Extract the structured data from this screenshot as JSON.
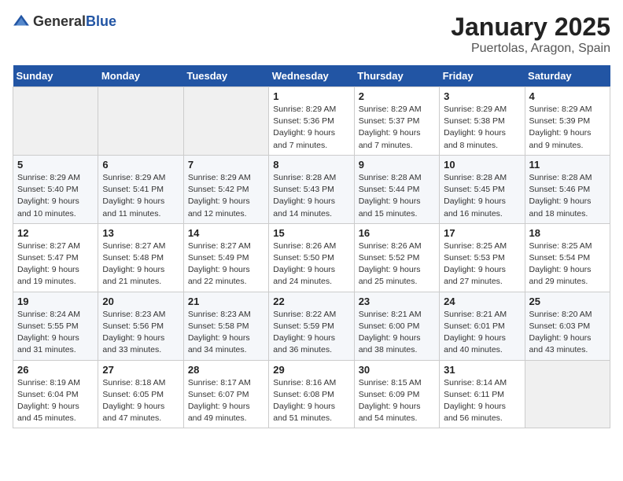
{
  "logo": {
    "text_general": "General",
    "text_blue": "Blue"
  },
  "title": "January 2025",
  "subtitle": "Puertolas, Aragon, Spain",
  "days_of_week": [
    "Sunday",
    "Monday",
    "Tuesday",
    "Wednesday",
    "Thursday",
    "Friday",
    "Saturday"
  ],
  "weeks": [
    [
      {
        "num": "",
        "detail": ""
      },
      {
        "num": "",
        "detail": ""
      },
      {
        "num": "",
        "detail": ""
      },
      {
        "num": "1",
        "detail": "Sunrise: 8:29 AM\nSunset: 5:36 PM\nDaylight: 9 hours\nand 7 minutes."
      },
      {
        "num": "2",
        "detail": "Sunrise: 8:29 AM\nSunset: 5:37 PM\nDaylight: 9 hours\nand 7 minutes."
      },
      {
        "num": "3",
        "detail": "Sunrise: 8:29 AM\nSunset: 5:38 PM\nDaylight: 9 hours\nand 8 minutes."
      },
      {
        "num": "4",
        "detail": "Sunrise: 8:29 AM\nSunset: 5:39 PM\nDaylight: 9 hours\nand 9 minutes."
      }
    ],
    [
      {
        "num": "5",
        "detail": "Sunrise: 8:29 AM\nSunset: 5:40 PM\nDaylight: 9 hours\nand 10 minutes."
      },
      {
        "num": "6",
        "detail": "Sunrise: 8:29 AM\nSunset: 5:41 PM\nDaylight: 9 hours\nand 11 minutes."
      },
      {
        "num": "7",
        "detail": "Sunrise: 8:29 AM\nSunset: 5:42 PM\nDaylight: 9 hours\nand 12 minutes."
      },
      {
        "num": "8",
        "detail": "Sunrise: 8:28 AM\nSunset: 5:43 PM\nDaylight: 9 hours\nand 14 minutes."
      },
      {
        "num": "9",
        "detail": "Sunrise: 8:28 AM\nSunset: 5:44 PM\nDaylight: 9 hours\nand 15 minutes."
      },
      {
        "num": "10",
        "detail": "Sunrise: 8:28 AM\nSunset: 5:45 PM\nDaylight: 9 hours\nand 16 minutes."
      },
      {
        "num": "11",
        "detail": "Sunrise: 8:28 AM\nSunset: 5:46 PM\nDaylight: 9 hours\nand 18 minutes."
      }
    ],
    [
      {
        "num": "12",
        "detail": "Sunrise: 8:27 AM\nSunset: 5:47 PM\nDaylight: 9 hours\nand 19 minutes."
      },
      {
        "num": "13",
        "detail": "Sunrise: 8:27 AM\nSunset: 5:48 PM\nDaylight: 9 hours\nand 21 minutes."
      },
      {
        "num": "14",
        "detail": "Sunrise: 8:27 AM\nSunset: 5:49 PM\nDaylight: 9 hours\nand 22 minutes."
      },
      {
        "num": "15",
        "detail": "Sunrise: 8:26 AM\nSunset: 5:50 PM\nDaylight: 9 hours\nand 24 minutes."
      },
      {
        "num": "16",
        "detail": "Sunrise: 8:26 AM\nSunset: 5:52 PM\nDaylight: 9 hours\nand 25 minutes."
      },
      {
        "num": "17",
        "detail": "Sunrise: 8:25 AM\nSunset: 5:53 PM\nDaylight: 9 hours\nand 27 minutes."
      },
      {
        "num": "18",
        "detail": "Sunrise: 8:25 AM\nSunset: 5:54 PM\nDaylight: 9 hours\nand 29 minutes."
      }
    ],
    [
      {
        "num": "19",
        "detail": "Sunrise: 8:24 AM\nSunset: 5:55 PM\nDaylight: 9 hours\nand 31 minutes."
      },
      {
        "num": "20",
        "detail": "Sunrise: 8:23 AM\nSunset: 5:56 PM\nDaylight: 9 hours\nand 33 minutes."
      },
      {
        "num": "21",
        "detail": "Sunrise: 8:23 AM\nSunset: 5:58 PM\nDaylight: 9 hours\nand 34 minutes."
      },
      {
        "num": "22",
        "detail": "Sunrise: 8:22 AM\nSunset: 5:59 PM\nDaylight: 9 hours\nand 36 minutes."
      },
      {
        "num": "23",
        "detail": "Sunrise: 8:21 AM\nSunset: 6:00 PM\nDaylight: 9 hours\nand 38 minutes."
      },
      {
        "num": "24",
        "detail": "Sunrise: 8:21 AM\nSunset: 6:01 PM\nDaylight: 9 hours\nand 40 minutes."
      },
      {
        "num": "25",
        "detail": "Sunrise: 8:20 AM\nSunset: 6:03 PM\nDaylight: 9 hours\nand 43 minutes."
      }
    ],
    [
      {
        "num": "26",
        "detail": "Sunrise: 8:19 AM\nSunset: 6:04 PM\nDaylight: 9 hours\nand 45 minutes."
      },
      {
        "num": "27",
        "detail": "Sunrise: 8:18 AM\nSunset: 6:05 PM\nDaylight: 9 hours\nand 47 minutes."
      },
      {
        "num": "28",
        "detail": "Sunrise: 8:17 AM\nSunset: 6:07 PM\nDaylight: 9 hours\nand 49 minutes."
      },
      {
        "num": "29",
        "detail": "Sunrise: 8:16 AM\nSunset: 6:08 PM\nDaylight: 9 hours\nand 51 minutes."
      },
      {
        "num": "30",
        "detail": "Sunrise: 8:15 AM\nSunset: 6:09 PM\nDaylight: 9 hours\nand 54 minutes."
      },
      {
        "num": "31",
        "detail": "Sunrise: 8:14 AM\nSunset: 6:11 PM\nDaylight: 9 hours\nand 56 minutes."
      },
      {
        "num": "",
        "detail": ""
      }
    ]
  ]
}
